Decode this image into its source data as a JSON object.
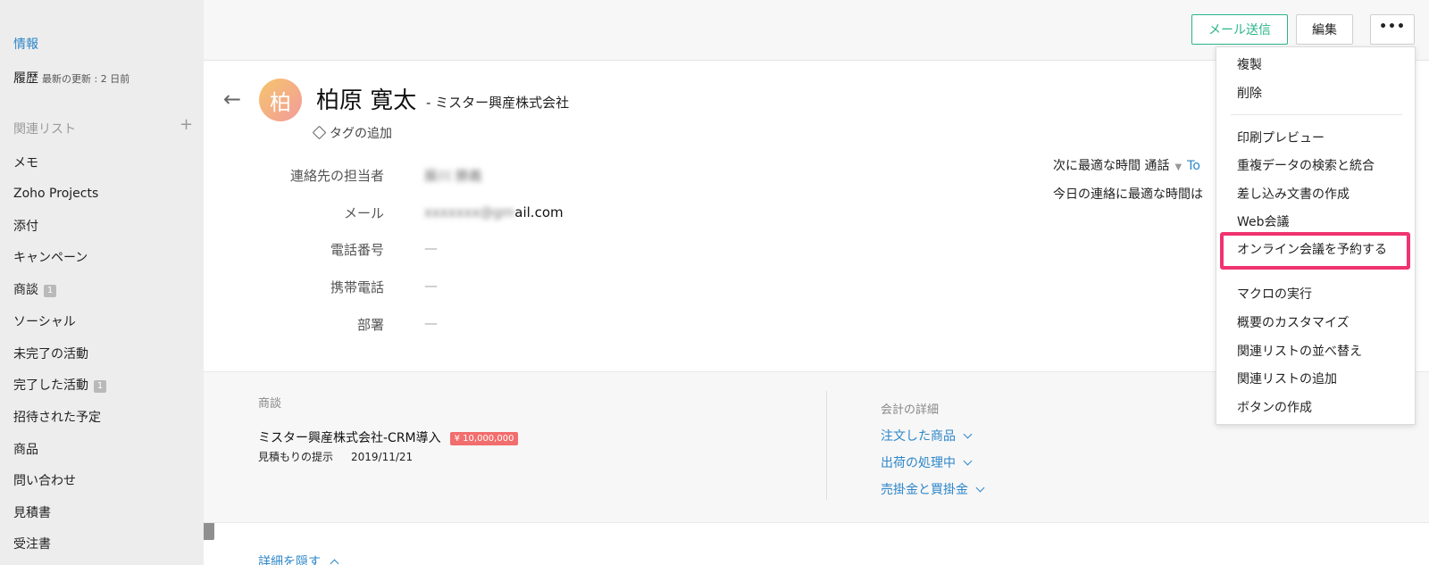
{
  "sidebar": {
    "info": "情報",
    "history": {
      "label": "履歴",
      "sub": "最新の更新 : 2 日前"
    },
    "related_header": "関連リスト",
    "plus": "+",
    "items": [
      {
        "label": "メモ"
      },
      {
        "label": "Zoho Projects"
      },
      {
        "label": "添付"
      },
      {
        "label": "キャンペーン"
      },
      {
        "label": "商談",
        "badge": "1"
      },
      {
        "label": "ソーシャル"
      },
      {
        "label": "未完了の活動"
      },
      {
        "label": "完了した活動",
        "badge": "1"
      },
      {
        "label": "招待された予定"
      },
      {
        "label": "商品"
      },
      {
        "label": "問い合わせ"
      },
      {
        "label": "見積書"
      },
      {
        "label": "受注書"
      }
    ],
    "collapse": "‹"
  },
  "toolbar": {
    "send_mail": "メール送信",
    "edit": "編集",
    "more": "•••"
  },
  "record": {
    "back": "←",
    "avatar_initial": "柏",
    "name": "柏原 寛太",
    "company": "- ミスター興産株式会社",
    "add_tag": "タグの追加"
  },
  "fields": [
    {
      "label": "連絡先の担当者",
      "value": "藤川 勝義",
      "blurred": true
    },
    {
      "label": "メール",
      "value_blur": "xxxxxxx@gm",
      "value": "ail.com"
    },
    {
      "label": "電話番号",
      "value": "—"
    },
    {
      "label": "携帯電話",
      "value": "—"
    },
    {
      "label": "部署",
      "value": "—"
    }
  ],
  "best_time": {
    "label": "次に最適な時間 通話",
    "caret": "▼",
    "link": "To",
    "today": "今日の連絡に最適な時間は"
  },
  "deals": {
    "title": "商談",
    "name": "ミスター興産株式会社-CRM導入",
    "amount": "¥ 10,000,000",
    "stage": "見積もりの提示",
    "date": "2019/11/21"
  },
  "accounting": {
    "title": "会計の詳細",
    "links": [
      "注文した商品",
      "出荷の処理中",
      "売掛金と買掛金"
    ]
  },
  "hide_details": "詳細を隠す",
  "menu": {
    "items": [
      "複製",
      "削除",
      "印刷プレビュー",
      "重複データの検索と統合",
      "差し込み文書の作成",
      "Web会議",
      "オンライン会議を予約する",
      "マクロの実行",
      "概要のカスタマイズ",
      "関連リストの並べ替え",
      "関連リストの追加",
      "ボタンの作成"
    ],
    "highlight_color": "#f0336f"
  },
  "colors": {
    "accent_blue": "#2c86c9",
    "mail_green": "#2bb38a",
    "amount_red": "#f26d6d"
  }
}
